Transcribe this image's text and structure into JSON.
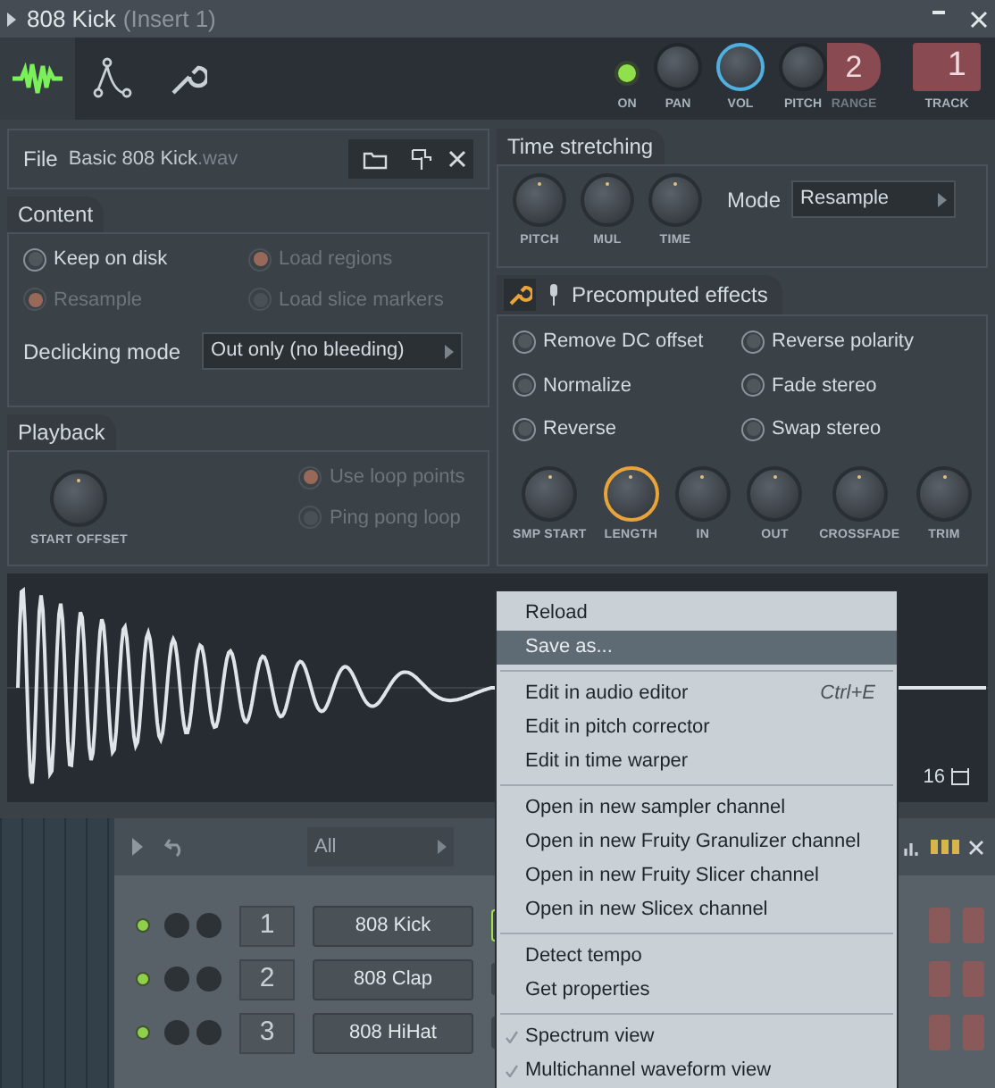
{
  "window": {
    "title": "808 Kick",
    "subtitle": "(Insert 1)"
  },
  "toolbar": {
    "tabs": [
      {
        "kind": "wave",
        "selected": true
      },
      {
        "kind": "envelope",
        "selected": false
      },
      {
        "kind": "wrench",
        "selected": false
      }
    ],
    "on": {
      "label": "ON",
      "on": true
    },
    "knobs": [
      {
        "label": "PAN",
        "active": false
      },
      {
        "label": "VOL",
        "active": true
      },
      {
        "label": "PITCH",
        "active": false
      }
    ],
    "range": {
      "value": "2",
      "label": "RANGE"
    },
    "track": {
      "value": "1",
      "label": "TRACK"
    }
  },
  "file": {
    "label": "File",
    "name": "Basic 808 Kick",
    "extension": ".wav"
  },
  "content": {
    "title": "Content",
    "options": [
      {
        "label": "Keep on disk",
        "checked": false,
        "disabled": false
      },
      {
        "label": "Load regions",
        "checked": true,
        "disabled": true
      },
      {
        "label": "Resample",
        "checked": true,
        "disabled": true
      },
      {
        "label": "Load slice markers",
        "checked": false,
        "disabled": true
      }
    ],
    "declicking": {
      "label": "Declicking mode",
      "value": "Out only (no bleeding)"
    }
  },
  "playback": {
    "title": "Playback",
    "knob": {
      "label": "START OFFSET",
      "active": false
    },
    "options": [
      {
        "label": "Use loop points",
        "checked": true,
        "disabled": true
      },
      {
        "label": "Ping pong loop",
        "checked": false,
        "disabled": true
      }
    ]
  },
  "time_stretching": {
    "title": "Time stretching",
    "knobs": [
      {
        "label": "PITCH",
        "active": false
      },
      {
        "label": "MUL",
        "active": false
      },
      {
        "label": "TIME",
        "active": false
      }
    ],
    "mode": {
      "label": "Mode",
      "value": "Resample"
    }
  },
  "precomputed": {
    "title": "Precomputed effects",
    "options": [
      {
        "label": "Remove DC offset",
        "checked": false
      },
      {
        "label": "Reverse polarity",
        "checked": false
      },
      {
        "label": "Normalize",
        "checked": false
      },
      {
        "label": "Fade stereo",
        "checked": false
      },
      {
        "label": "Reverse",
        "checked": false
      },
      {
        "label": "Swap stereo",
        "checked": false
      }
    ],
    "knobs": [
      {
        "label": "SMP START",
        "active": false
      },
      {
        "label": "LENGTH",
        "active": true
      },
      {
        "label": "IN",
        "active": false
      },
      {
        "label": "OUT",
        "active": false
      },
      {
        "label": "CROSSFADE",
        "active": false
      },
      {
        "label": "TRIM",
        "active": false
      }
    ]
  },
  "waveform": {
    "resolution": "16"
  },
  "channel_rack": {
    "filter": "All",
    "channels": [
      {
        "number": "1",
        "name": "808 Kick",
        "selected": true
      },
      {
        "number": "2",
        "name": "808 Clap",
        "selected": false
      },
      {
        "number": "3",
        "name": "808 HiHat",
        "selected": false
      }
    ]
  },
  "context_menu": {
    "items": [
      {
        "kind": "item",
        "label": "Reload",
        "selected": false
      },
      {
        "kind": "item",
        "label": "Save as...",
        "selected": true
      },
      {
        "kind": "separator"
      },
      {
        "kind": "item",
        "label": "Edit in audio editor",
        "shortcut": "Ctrl+E",
        "selected": false
      },
      {
        "kind": "item",
        "label": "Edit in pitch corrector",
        "selected": false
      },
      {
        "kind": "item",
        "label": "Edit in time warper",
        "selected": false
      },
      {
        "kind": "separator"
      },
      {
        "kind": "item",
        "label": "Open in new sampler channel",
        "selected": false
      },
      {
        "kind": "item",
        "label": "Open in new Fruity Granulizer channel",
        "selected": false
      },
      {
        "kind": "item",
        "label": "Open in new Fruity Slicer channel",
        "selected": false
      },
      {
        "kind": "item",
        "label": "Open in new Slicex channel",
        "selected": false
      },
      {
        "kind": "separator"
      },
      {
        "kind": "item",
        "label": "Detect tempo",
        "selected": false
      },
      {
        "kind": "item",
        "label": "Get properties",
        "selected": false
      },
      {
        "kind": "separator"
      },
      {
        "kind": "item",
        "label": "Spectrum view",
        "checked": true,
        "selected": false
      },
      {
        "kind": "item",
        "label": "Multichannel waveform view",
        "checked": true,
        "selected": false
      }
    ]
  }
}
